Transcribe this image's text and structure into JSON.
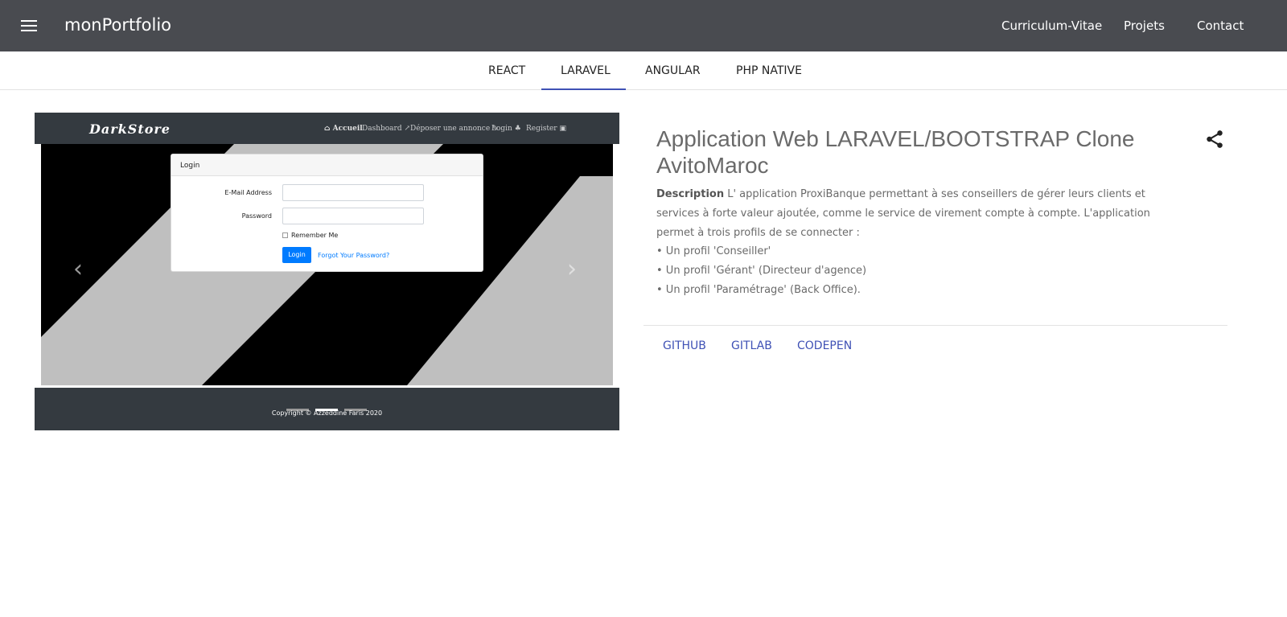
{
  "appbar": {
    "brand": "monPortfolio",
    "nav": [
      "Curriculum-Vitae",
      "Projets",
      "Contact"
    ]
  },
  "tabs": [
    "REACT",
    "LARAVEL",
    "ANGULAR",
    "PHP NATIVE"
  ],
  "active_tab": "LARAVEL",
  "screenshot": {
    "logo": "DarkStore",
    "nav": [
      "Accueil",
      "Dashboard",
      "Déposer une annonce",
      "Login",
      "Register"
    ],
    "login_title": "Login",
    "email_label": "E-Mail Address",
    "password_label": "Password",
    "remember_label": "Remember Me",
    "login_button": "Login",
    "forgot_link": "Forgot Your Password?",
    "copyright": "Copyright © Azzeddine Faris 2020"
  },
  "project": {
    "title": "Application Web LARAVEL/BOOTSTRAP Clone AvitoMaroc",
    "description_label": "Description",
    "description_text": " L' application ProxiBanque permettant à ses conseillers de gérer leurs clients et services à forte valeur ajoutée, comme le service de virement compte à compte. L'application permet à trois profils de se connecter :",
    "bullets": [
      "• Un profil 'Conseiller'",
      "• Un profil 'Gérant' (Directeur d'agence)",
      "• Un profil 'Paramétrage' (Back Office)."
    ],
    "links": [
      "GITHUB",
      "GITLAB",
      "CODEPEN"
    ]
  },
  "colors": {
    "appbar": "#494b50",
    "accent": "#3f51b5",
    "screenshot_dark": "#343a40",
    "login_blue": "#007bff"
  }
}
